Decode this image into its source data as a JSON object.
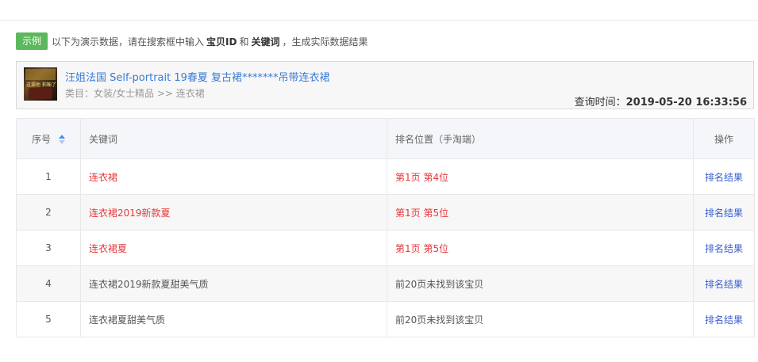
{
  "notice": {
    "badge": "示例",
    "text_1": "以下为演示数据，请在搜索框中输入",
    "strong_1": "宝贝ID",
    "text_2": "和",
    "strong_2": "关键词",
    "text_3": "，生成实际数据结果"
  },
  "product": {
    "thumb_text": "这漏他 莉鞠了",
    "title": "汪姐法国 Self-portrait 19春夏 复古裙*******吊带连衣裙",
    "category": "类目：女装/女士精品 >> 连衣裙",
    "query_label": "查询时间：",
    "query_time": "2019-05-20 16:33:56"
  },
  "table": {
    "headers": {
      "index": "序号",
      "keyword": "关键词",
      "position": "排名位置（手淘端）",
      "action": "操作"
    },
    "rows": [
      {
        "index": "1",
        "keyword": "连衣裙",
        "position": "第1页 第4位",
        "action": "排名结果",
        "found": true
      },
      {
        "index": "2",
        "keyword": "连衣裙2019新款夏",
        "position": "第1页 第5位",
        "action": "排名结果",
        "found": true
      },
      {
        "index": "3",
        "keyword": "连衣裙夏",
        "position": "第1页 第5位",
        "action": "排名结果",
        "found": true
      },
      {
        "index": "4",
        "keyword": "连衣裙2019新款夏甜美气质",
        "position": "前20页未找到该宝贝",
        "action": "排名结果",
        "found": false
      },
      {
        "index": "5",
        "keyword": "连衣裙夏甜美气质",
        "position": "前20页未找到该宝贝",
        "action": "排名结果",
        "found": false
      }
    ]
  },
  "colors": {
    "badge": "#5cb85c",
    "title_link": "#3a7bd5",
    "found_text": "#e4393c",
    "action_link": "#3a5fcd"
  }
}
